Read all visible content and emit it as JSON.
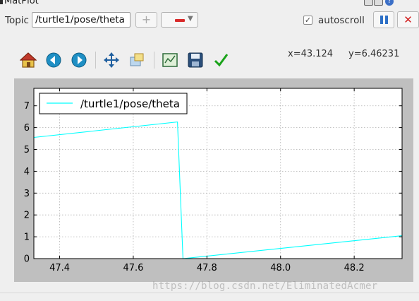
{
  "window": {
    "title": "MatPlot",
    "icons": [
      "app-icon",
      "help-icon",
      "minimize-icon"
    ]
  },
  "topic_bar": {
    "label": "Topic",
    "input_value": "/turtle1/pose/theta",
    "add_label": "+",
    "add_enabled": false,
    "remove_icon": "minus-icon",
    "autoscroll_checked": true,
    "autoscroll_label": "autoscroll",
    "pause_icon": "pause-icon",
    "clear_label": "✕"
  },
  "toolbar": {
    "tools": [
      {
        "name": "home-icon"
      },
      {
        "name": "back-icon"
      },
      {
        "name": "forward-icon"
      },
      {
        "name": "pan-icon"
      },
      {
        "name": "zoom-icon"
      },
      {
        "name": "subplots-icon"
      },
      {
        "name": "save-icon"
      },
      {
        "name": "edit-axis-icon"
      }
    ],
    "x_readout": "x=43.124",
    "y_readout": "y=6.46231"
  },
  "watermark": "https://blog.csdn.net/EliminatedAcmer",
  "colors": {
    "series": "#00ffff",
    "plot_bg": "#ffffff",
    "frame_bg": "#bfbfbf",
    "grid": "#b0b0b0"
  },
  "chart_data": {
    "type": "line",
    "title": "",
    "xlabel": "",
    "ylabel": "",
    "xlim": [
      47.33,
      48.33
    ],
    "ylim": [
      0,
      7.8
    ],
    "xticks": [
      47.4,
      47.6,
      47.8,
      48.0,
      48.2
    ],
    "xtick_labels": [
      "47.4",
      "47.6",
      "47.8",
      "48.0",
      "48.2"
    ],
    "yticks": [
      0,
      1,
      2,
      3,
      4,
      5,
      6,
      7
    ],
    "ytick_labels": [
      "0",
      "1",
      "2",
      "3",
      "4",
      "5",
      "6",
      "7"
    ],
    "grid": true,
    "legend": "top-left",
    "series": [
      {
        "name": "/turtle1/pose/theta",
        "x": [
          47.33,
          47.72,
          47.735,
          48.33
        ],
        "y": [
          5.55,
          6.26,
          0.0,
          1.05
        ]
      }
    ]
  }
}
